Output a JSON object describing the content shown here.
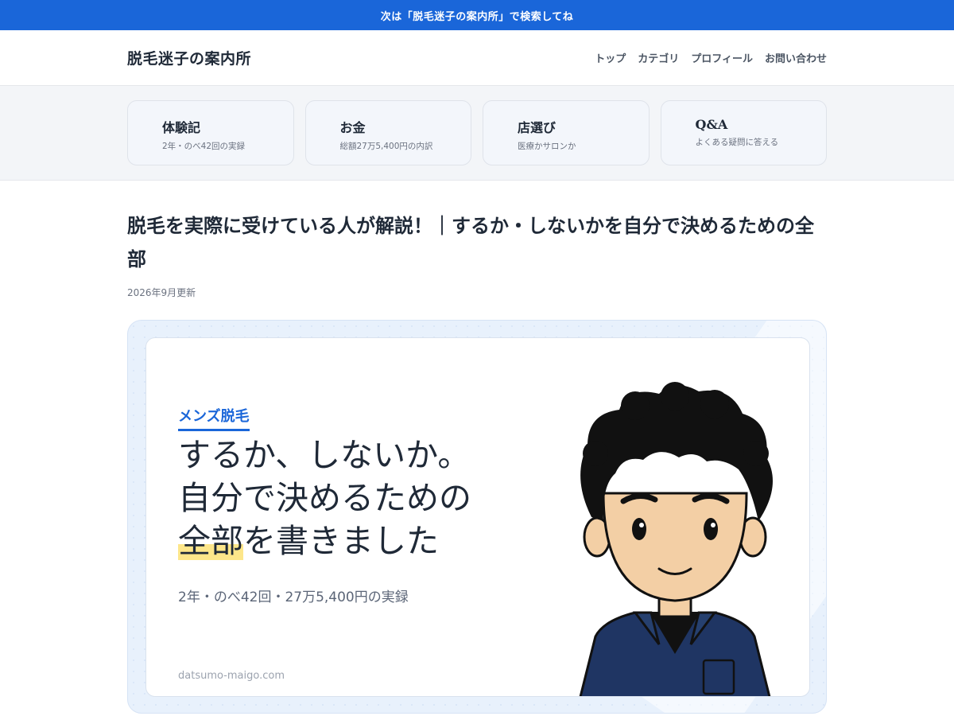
{
  "announcement": "次は「脱毛迷子の案内所」で検索してね",
  "header": {
    "brand": "脱毛迷子の案内所",
    "nav": [
      "トップ",
      "カテゴリ",
      "プロフィール",
      "お問い合わせ"
    ]
  },
  "cards": [
    {
      "title": "体験記",
      "sub": "2年・のべ42回の実録"
    },
    {
      "title": "お金",
      "sub": "総額27万5,400円の内訳"
    },
    {
      "title": "店選び",
      "sub": "医療かサロンか"
    },
    {
      "title": "Q&A",
      "sub": "よくある疑問に答える"
    }
  ],
  "article": {
    "title": "脱毛を実際に受けている人が解説！｜するか・しないかを自分で決めるための全部",
    "updated": "2026年9月更新"
  },
  "hero": {
    "tag": "メンズ脱毛",
    "line1": "するか、しないか。",
    "line2": "自分で決めるための",
    "line3_highlight": "全部",
    "line3_rest": "を書きました",
    "meta": "2年・のべ42回・27万5,400円の実録",
    "domain": "datsumo-maigo.com"
  },
  "colors": {
    "accent": "#1a66d9",
    "highlight": "#fde68a",
    "band": "#f3f5f8"
  }
}
